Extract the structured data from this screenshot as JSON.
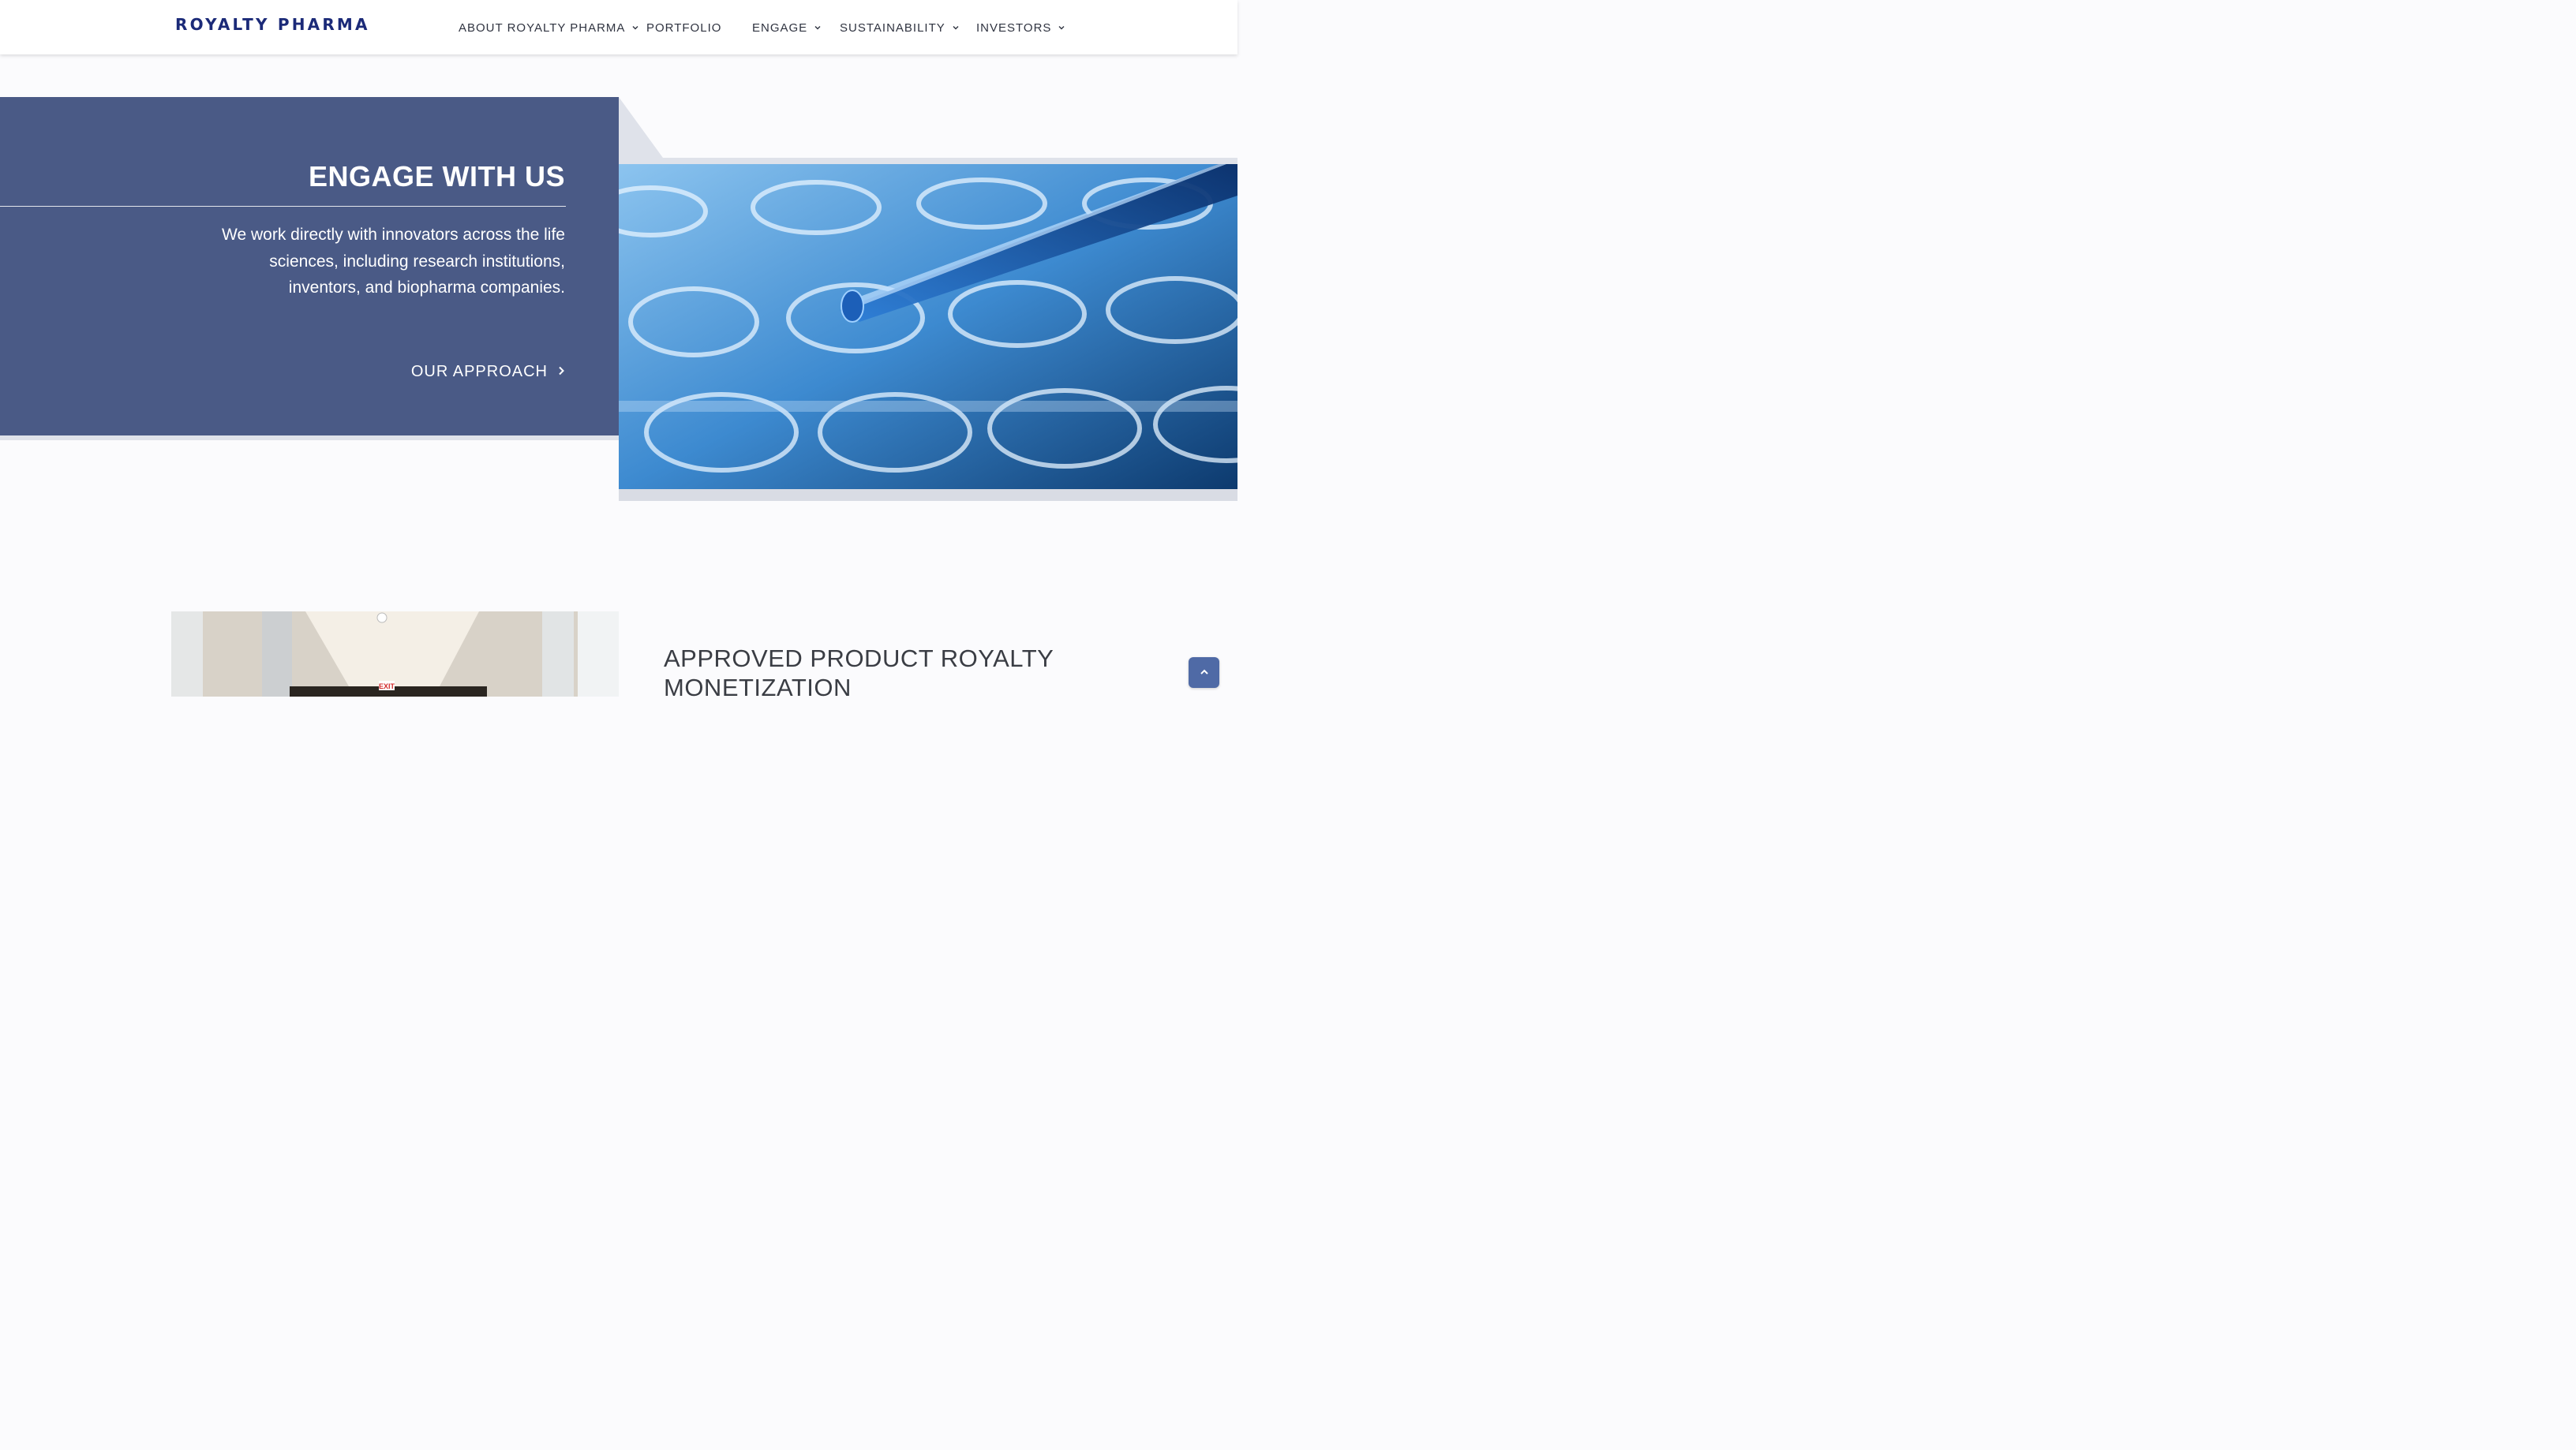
{
  "header": {
    "logo_text": "ROYALTY PHARMA",
    "nav": [
      {
        "label": "ABOUT ROYALTY PHARMA",
        "has_dropdown": true
      },
      {
        "label": "PORTFOLIO",
        "has_dropdown": false
      },
      {
        "label": "ENGAGE",
        "has_dropdown": true
      },
      {
        "label": "SUSTAINABILITY",
        "has_dropdown": true
      },
      {
        "label": "INVESTORS",
        "has_dropdown": true
      }
    ]
  },
  "engage": {
    "title": "ENGAGE WITH US",
    "body": "We work directly with innovators across the life sciences, including research institutions, inventors, and biopharma companies.",
    "link_label": "OUR APPROACH",
    "link_icon": "chevron-right-icon"
  },
  "section2": {
    "title": "APPROVED PRODUCT ROYALTY MONETIZATION",
    "photo_sign": "EXIT"
  },
  "scroll_top_icon": "chevron-up-icon",
  "colors": {
    "brand_navy": "#1b2a78",
    "panel_blue": "#4a5a86",
    "scroll_button": "#4f6aa6",
    "page_bg": "#fbfbfd"
  }
}
